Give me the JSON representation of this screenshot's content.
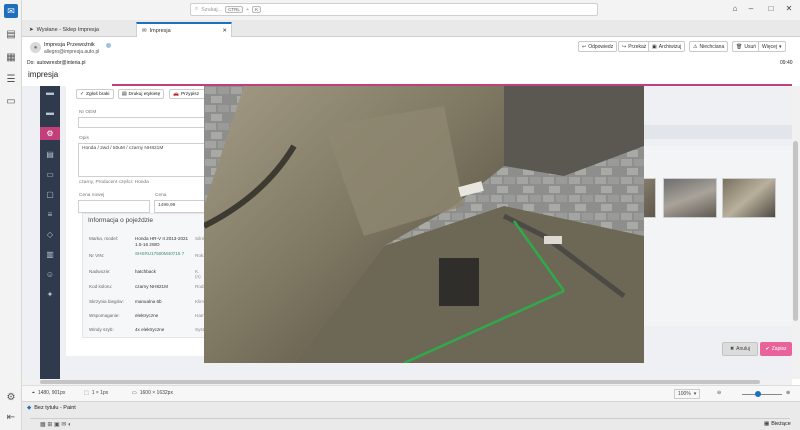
{
  "search": {
    "placeholder": "Szukaj...",
    "shortcut_key1": "CTRL",
    "shortcut_key2": "K"
  },
  "tabs": [
    {
      "label": "Wysłane - Sklep Impresja"
    },
    {
      "label": "Impresja"
    }
  ],
  "message": {
    "sender_name": "Impresja Przewoźnik",
    "sender_email": "allegro@impresja.auto.pl",
    "to_prefix": "Do:",
    "to_email": "autowrexbr@interia.pl",
    "time": "09:40",
    "subject": "impresja"
  },
  "toolbar": {
    "reply": "Odpowiedz",
    "forward": "Przekaż",
    "archive": "Archiwizuj",
    "junk": "Niechciana",
    "delete": "Usuń",
    "more": "Więcej"
  },
  "form": {
    "btn_close": "Zgłoś braki",
    "btn_print": "Drukuj etykietę",
    "btn_assign": "Przypisz",
    "oem_label": "Nr OEM",
    "desc_label": "Opis",
    "desc_value": "Honda / 2wd / 50uM / czarny NH821M",
    "desc_hint": "czarny, Producent części: Honda",
    "price_new_label": "Cena nowej",
    "price_label": "Cena",
    "price_value": "1499,99"
  },
  "specs": {
    "title": "Informacja o pojeździe",
    "rows": [
      {
        "k": "Marka, model:",
        "v": "Honda HR-V II 2013-2021 1.5-16 2WD",
        "s": "Silnik:"
      },
      {
        "k": "Nr VIN:",
        "v": "SHSRU17500M40715 7",
        "s": "Rok:"
      },
      {
        "k": "Nadwozie:",
        "v": "hatchback",
        "s": "K. (n)"
      },
      {
        "k": "Kod koloru:",
        "v": "czarny NH821M",
        "s": "Rodz."
      },
      {
        "k": "Skrzynia biegów:",
        "v": "manualna 6b",
        "s": "Klim."
      },
      {
        "k": "Wspomaganie:",
        "v": "elektryczne",
        "s": "Ham."
      },
      {
        "k": "Windy szyb:",
        "v": "4x elektryczne",
        "s": "Syst."
      }
    ]
  },
  "actions": {
    "cancel": "Anuluj",
    "save": "Zapisz"
  },
  "paint": {
    "cursor_pos": "1480, 901px",
    "selection": "1 × 1px",
    "image_size": "1600 × 1632px",
    "zoom": "100%"
  },
  "taskbar": {
    "paint_title": "Bez tytułu - Paint",
    "tray_label": "Bieżące"
  },
  "colors": {
    "accent": "#c2407a",
    "brand": "#1f6fbf",
    "save": "#e8639a",
    "rail": "#2f3b4c"
  }
}
